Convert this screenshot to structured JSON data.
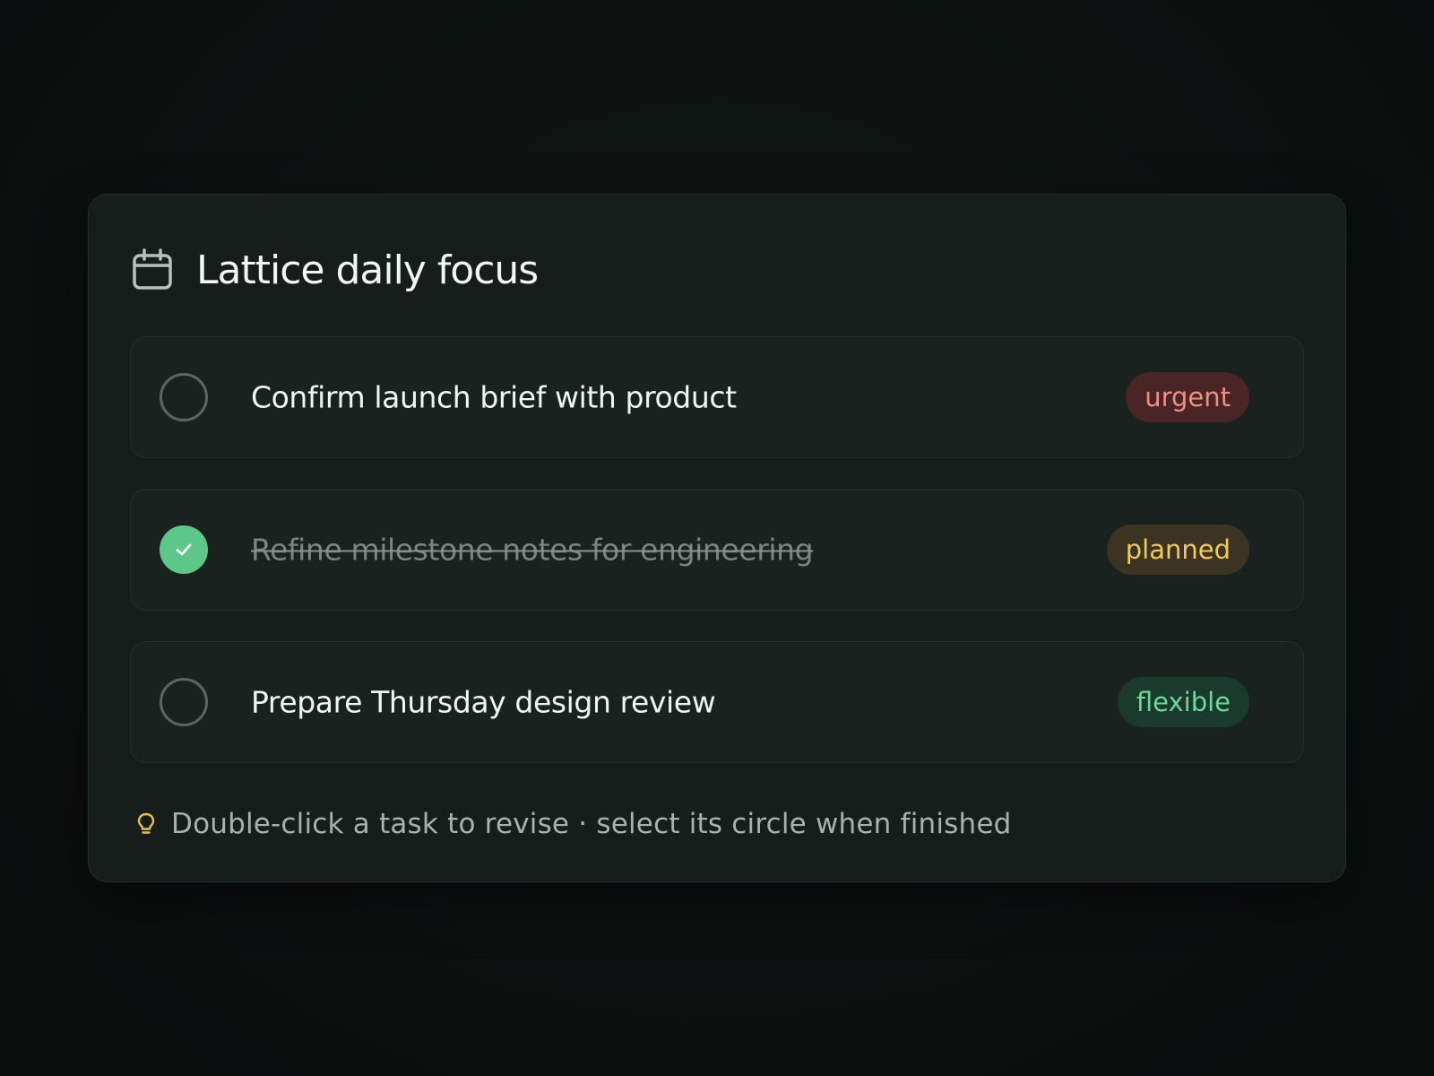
{
  "card": {
    "title": "Lattice daily focus",
    "title_icon": "calendar-icon"
  },
  "tasks": [
    {
      "label": "Confirm launch brief with product",
      "done": false,
      "tag": "urgent",
      "tag_color": "#f08f83"
    },
    {
      "label": "Refine milestone notes for engineering",
      "done": true,
      "tag": "planned",
      "tag_color": "#f2c95c"
    },
    {
      "label": "Prepare Thursday design review",
      "done": false,
      "tag": "flexible",
      "tag_color": "#6ed79c"
    }
  ],
  "hint": {
    "icon": "lightbulb-icon",
    "text": "Double-click a task to revise · select its circle when finished"
  },
  "colors": {
    "background": "#0c1110",
    "card": "#161d1b",
    "check_done": "#5dc787"
  }
}
